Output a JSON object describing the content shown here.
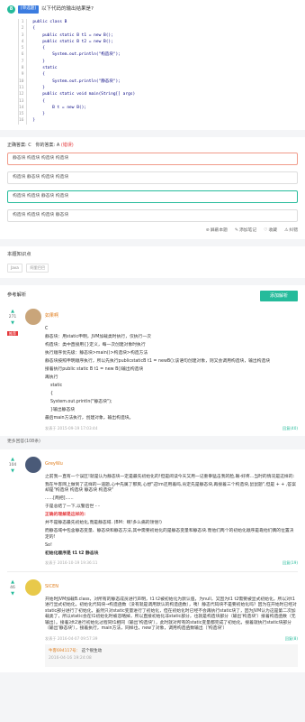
{
  "question": {
    "number": "8",
    "type": "[单选题]",
    "title": "以下代码的输出结果是?",
    "line_numbers": [
      "1",
      "2",
      "3",
      "4",
      "5",
      "6",
      "7",
      "8",
      "9",
      "10",
      "11",
      "12",
      "13",
      "14",
      "15",
      "16"
    ],
    "code": [
      "public class B",
      "{",
      "    public static B t1 = new B();",
      "    public static B t2 = new B();",
      "    {",
      "        System.out.println(\"构造块\");",
      "    }",
      "    static",
      "    {",
      "        System.out.println(\"静态块\");",
      "    }",
      "    public static void main(String[] args)",
      "    {",
      "        B t = new B();",
      "    }",
      "}"
    ]
  },
  "answer": {
    "correct_label": "正确答案: C",
    "yours_label": "你的答案: A",
    "yours_status": "(错误)"
  },
  "options": [
    "静态块  构造块  构造块  构造块",
    "构造块  静态块  构造块  构造块",
    "构造块  构造块  静态块  构造块",
    "构造块  构造块  构造块  静态块"
  ],
  "tools": {
    "fold": "屏蔽本题",
    "note": "添加笔记",
    "fav": "收藏",
    "error": "纠错"
  },
  "knowledge": {
    "title": "本题知识点",
    "tags": [
      "Java",
      "阿里巴巴"
    ]
  },
  "reference": {
    "title": "参考解析",
    "add_button": "添加解析"
  },
  "posts": [
    {
      "votes": "271",
      "best": "推荐",
      "user": "如果啊",
      "lines": [
        "C",
        "静态块：用static申明，JVM加载类时执行，仅执行一次",
        "构造块：类中直接用{}定义，每一次创建对象时执行",
        "执行顺序优先级：静态块>main()>构造块>构造方法",
        "静态块按照申明顺序执行，所以先执行publicstaticB t1 = newB();该语句创建对象，则又会调用构造块，输出构造块",
        "接着执行public static B t1 = new B()输出构造块",
        "再执行",
        "static",
        "{",
        "System.out.println(\"静态块\");",
        "}输出静态块",
        "最后main方法执行，创建对象，输出构造块。"
      ],
      "date": "发表于 2015-09-19 17:03:44",
      "reply": "回复(40)"
    },
    {
      "votes": "104",
      "user": "GreyWu",
      "lines": [
        "之前我一直有一个误区!就是认为静态块一定是最先初始化的!但是阅读今天又用一记重拳猛击我的脸,眼-好疼...当时的情况是这样的:",
        "我在牛客网上做到了这样的一道题,心中先属了那爽,心想\"这tm还用着吗,肯定先是静态块,再接着三个构造块,鼠鼠题\",但是 + + ,答案却是\"构造块 构造块 静态块 构造块\"",
        "......[两把]......",
        "于是总结了一下,以警后世 - -",
        "正确的理解是这样的:",
        "并不是静态最先初始化,而是静态域. (BM：啊!多么痛的领悟!)",
        "而静态域中包含静态变量、静态块和静态方法,其中需要初始化的是静态变量和静态块.而他们两个的初始化顺序是靠他们俩的位置决定的!",
        "So!",
        "初始化顺序是 t1 t2 静态块"
      ],
      "date": "发表于 2016-10-19 19:36:11",
      "reply": "回复(19)"
    },
    {
      "votes": "46",
      "user": "SICEN",
      "lines": [
        "开始时JVM加载B.class，对所有的静态成员进行声明，t1 t2被初始化为默认值，为null，又因为t1 t2需要被显式初始化，所以对t1进行显式初始化，初始化代码块→构造函数（没有就是调用默认的构造函数），咦！静态代码块不是要初始化吗？因为在开始时已经对static部分进行了初始化，虽然只对static变量进行了初始化，但在初始化时已经不会再执行static块了，因为JVM认为这是第二次加载类了，所以static会在t1初始化时被忽略掉，所以直接初始化非static部分，也就是构造块部分（输出'构造块'）接着构造函数（无输出）。接着对t2进行初始化过程同t1相同（输出'构造块'），此时就对所有的static变量都完成了初始化，接着就执行static块部分（输出'静态块'），接着执行，main方法，同样也，new了对象，调用构造函数输出（'构造块'）"
      ],
      "date": "发表于 2016-04-07 09:57:39",
      "reply": "回复(8)",
      "comment_user": "牛客694117号：",
      "comment_text": "这个很生动",
      "comment_date": "2016-04-16 19:24:08"
    }
  ],
  "more": "更多回答(108条)"
}
